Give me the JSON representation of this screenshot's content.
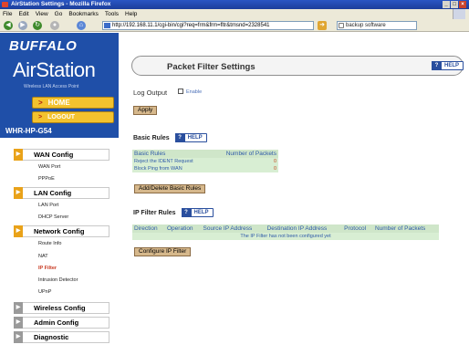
{
  "browser": {
    "window_title": "AirStation Settings - Mozilla Firefox",
    "menu": [
      "File",
      "Edit",
      "View",
      "Go",
      "Bookmarks",
      "Tools",
      "Help"
    ],
    "url": "http://192.168.11.1/cgi-bin/cgi?req=frm&frm=fltr&tmsnd=2328541",
    "search_value": "backup software"
  },
  "sidebar": {
    "logo": "BUFFALO",
    "product": "AirStation",
    "tagline": "Wireless LAN Access Point",
    "home_label": "HOME",
    "logout_label": "LOGOUT",
    "model": "WHR-HP-G54",
    "groups": [
      {
        "label": "WAN Config",
        "items": [
          "WAN Port",
          "PPPoE"
        ]
      },
      {
        "label": "LAN Config",
        "items": [
          "LAN Port",
          "DHCP Server"
        ]
      },
      {
        "label": "Network Config",
        "items": [
          "Route Info",
          "NAT",
          "IP Filter",
          "Intrusion Detector",
          "UPnP"
        ]
      },
      {
        "label": "Wireless Config",
        "items": []
      },
      {
        "label": "Admin Config",
        "items": []
      },
      {
        "label": "Diagnostic",
        "items": []
      }
    ]
  },
  "main": {
    "page_title": "Packet Filter Settings",
    "help_label": "HELP",
    "log_output_label": "Log Output",
    "enable_label": "Enable",
    "apply_label": "Apply",
    "basic_rules": {
      "title": "Basic Rules",
      "columns": [
        "Basic Rules",
        "Number of Packets"
      ],
      "rows": [
        [
          "Reject the IDENT Request",
          "0"
        ],
        [
          "Block Ping from WAN",
          "0"
        ]
      ],
      "button": "Add/Delete Basic Rules"
    },
    "ip_filter": {
      "title": "IP Filter Rules",
      "columns": [
        "Direction",
        "Operation",
        "Source IP Address",
        "Destination IP Address",
        "Protocol",
        "Number of Packets"
      ],
      "empty_message": "The IP Filter has not been configured yet",
      "button": "Configure IP Filter"
    }
  }
}
